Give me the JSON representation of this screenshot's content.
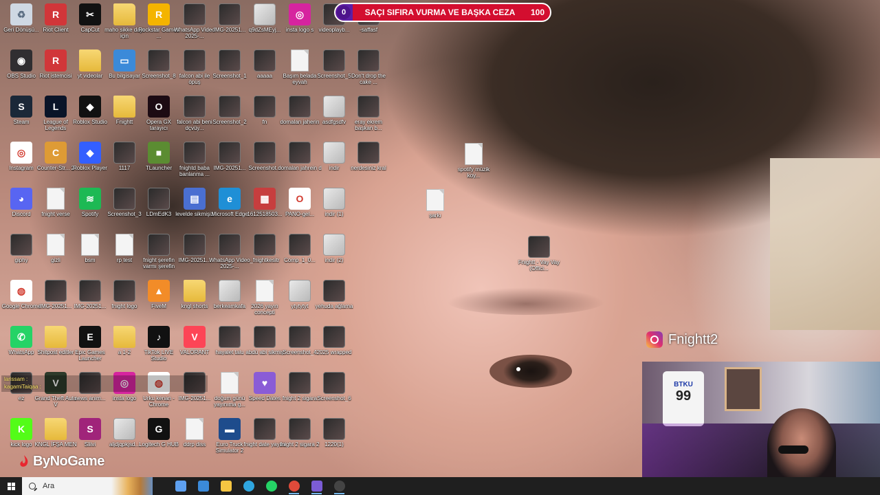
{
  "overlay_goal": {
    "current": "0",
    "title": "SAÇI SIFIRA VURMA VE BAŞKA CEZA",
    "max": "100",
    "progress_fraction": 0.04
  },
  "social_handle": {
    "platform_icon": "instagram-icon",
    "text": "Fnightt2"
  },
  "webcam": {
    "shirt_text": "BTKU",
    "shirt_number": "99"
  },
  "watermark": {
    "brand": "ByNoGame"
  },
  "chat": {
    "lines": [
      "larissam :",
      "kagamiTaiqaa :"
    ]
  },
  "taskbar": {
    "search_placeholder": "Ara",
    "pinned": [
      {
        "name": "copilot-icon",
        "color": "#5ea0ef"
      },
      {
        "name": "microsoft-store-icon",
        "color": "#3b8ad9"
      },
      {
        "name": "file-explorer-icon",
        "color": "#f5c542"
      },
      {
        "name": "edge-icon",
        "color": "#2fa6e0"
      },
      {
        "name": "whatsapp-icon",
        "color": "#25d366"
      },
      {
        "name": "chrome-icon",
        "color": "#e04a3a",
        "active": true
      },
      {
        "name": "speed-dates-icon",
        "color": "#7b5cd6",
        "active": true
      },
      {
        "name": "obs-icon",
        "color": "#444",
        "active": true
      }
    ]
  },
  "desktop_icons": [
    {
      "label": "Geri Dönüşü...",
      "type": "recycle",
      "color": "#cfd8e3"
    },
    {
      "label": "Riot Client",
      "type": "app",
      "color": "#d13639",
      "glyph": "R"
    },
    {
      "label": "CapCut",
      "type": "app",
      "color": "#111",
      "glyph": "✂"
    },
    {
      "label": "maho sikke dayı için",
      "type": "folder"
    },
    {
      "label": "Rockstar Games ...",
      "type": "app",
      "color": "#f4b400",
      "glyph": "R"
    },
    {
      "label": "WhatsApp Video 2025-...",
      "type": "thumb"
    },
    {
      "label": "IMG-20251...",
      "type": "thumb"
    },
    {
      "label": "q9dZsMEyj...",
      "type": "thumb-light"
    },
    {
      "label": "insta logo s",
      "type": "app",
      "color": "#d6249f",
      "glyph": "◎"
    },
    {
      "label": "videoplayb...",
      "type": "thumb"
    },
    {
      "label": "-saffasf",
      "type": "thumb"
    },
    {
      "label": "OBS Studio",
      "type": "app",
      "color": "#302e31",
      "glyph": "◉"
    },
    {
      "label": "Riot istemcisi",
      "type": "app",
      "color": "#d13639",
      "glyph": "R"
    },
    {
      "label": "yt videolar",
      "type": "folder"
    },
    {
      "label": "Bu bilgisayar",
      "type": "app",
      "color": "#3b8ad9",
      "glyph": "▭"
    },
    {
      "label": "Screenshot_8",
      "type": "thumb"
    },
    {
      "label": "falcon abi ile öpüş",
      "type": "thumb"
    },
    {
      "label": "Screenshot_1",
      "type": "thumb"
    },
    {
      "label": "aaaaa",
      "type": "thumb"
    },
    {
      "label": "Başım belada eyvah",
      "type": "doc"
    },
    {
      "label": "Screenshot_5",
      "type": "thumb"
    },
    {
      "label": "Don't drop the cake ...",
      "type": "thumb"
    },
    {
      "label": "Steam",
      "type": "app",
      "color": "#1b2838",
      "glyph": "S"
    },
    {
      "label": "League of Legends",
      "type": "app",
      "color": "#0a1428",
      "glyph": "L"
    },
    {
      "label": "Roblox Studio",
      "type": "app",
      "color": "#111",
      "glyph": "◆"
    },
    {
      "label": "Fnightt",
      "type": "folder"
    },
    {
      "label": "Opera GX tarayıcı",
      "type": "app",
      "color": "#1c0b13",
      "glyph": "O"
    },
    {
      "label": "falcon abi beni dçvüy...",
      "type": "thumb"
    },
    {
      "label": "Screenshot_2",
      "type": "thumb"
    },
    {
      "label": "fn",
      "type": "thumb"
    },
    {
      "label": "domalan jaherin",
      "type": "thumb"
    },
    {
      "label": "asdfgsdfv",
      "type": "thumb-light"
    },
    {
      "label": "eray ekrem başkan b...",
      "type": "thumb"
    },
    {
      "label": "Instagram",
      "type": "app",
      "color": "#ffffff",
      "glyph": "◎"
    },
    {
      "label": "Counter-Str... 2",
      "type": "app",
      "color": "#de9b35",
      "glyph": "C"
    },
    {
      "label": "Roblox Player",
      "type": "app",
      "color": "#335fff",
      "glyph": "◆"
    },
    {
      "label": "1117",
      "type": "thumb"
    },
    {
      "label": "TLauncher",
      "type": "app",
      "color": "#5b8c32",
      "glyph": "■"
    },
    {
      "label": "fnightd baba banlanma ...",
      "type": "thumb"
    },
    {
      "label": "IMG-20251...",
      "type": "thumb"
    },
    {
      "label": "Screenshot...",
      "type": "thumb"
    },
    {
      "label": "domalan jahrein d",
      "type": "thumb"
    },
    {
      "label": "indir",
      "type": "thumb-light"
    },
    {
      "label": "nerdesiniz kral",
      "type": "thumb"
    },
    {
      "label": "Discord",
      "type": "app",
      "color": "#5865f2",
      "glyph": "◕"
    },
    {
      "label": "fnight verse",
      "type": "doc"
    },
    {
      "label": "Spotify",
      "type": "app",
      "color": "#1db954",
      "glyph": "≋"
    },
    {
      "label": "Screenshot_3",
      "type": "thumb"
    },
    {
      "label": "LDmEdK3",
      "type": "thumb"
    },
    {
      "label": "levelde sikmişiz",
      "type": "app",
      "color": "#4a6fd1",
      "glyph": "▤"
    },
    {
      "label": "Microsoft Edge",
      "type": "app",
      "color": "#1f8fd6",
      "glyph": "e"
    },
    {
      "label": "1612518503...",
      "type": "app",
      "color": "#c73e3e",
      "glyph": "▦"
    },
    {
      "label": "PANO-gel...",
      "type": "app",
      "color": "#fff",
      "glyph": "O"
    },
    {
      "label": "indir (1)",
      "type": "thumb-light"
    },
    {
      "label": "giphy",
      "type": "thumb"
    },
    {
      "label": "gizli",
      "type": "doc"
    },
    {
      "label": "bsm",
      "type": "doc"
    },
    {
      "label": "rp test",
      "type": "doc"
    },
    {
      "label": "fnight şerefin varmı şerefin",
      "type": "thumb"
    },
    {
      "label": "IMG-20251...",
      "type": "thumb"
    },
    {
      "label": "WhatsApp Video 2025-...",
      "type": "thumb"
    },
    {
      "label": "_fnightkesitr",
      "type": "thumb"
    },
    {
      "label": "Comp_1_0...",
      "type": "thumb"
    },
    {
      "label": "indir (2)",
      "type": "thumb-light"
    },
    {
      "label": "Google Chrome",
      "type": "app",
      "color": "#fff",
      "glyph": "◍"
    },
    {
      "label": "IMG-20251...",
      "type": "thumb"
    },
    {
      "label": "IMG-20251...",
      "type": "thumb"
    },
    {
      "label": "fnight logo",
      "type": "thumb"
    },
    {
      "label": "FiveM",
      "type": "app",
      "color": "#f28c28",
      "glyph": "▲"
    },
    {
      "label": "kngl shorts",
      "type": "folder"
    },
    {
      "label": "berkeamkafa",
      "type": "thumb-light"
    },
    {
      "label": "2026 yayın concepti",
      "type": "doc"
    },
    {
      "label": "ytytytyt",
      "type": "thumb-light"
    },
    {
      "label": "yehuda ağlama",
      "type": "thumb"
    },
    {
      "label": "WhatsApp",
      "type": "app",
      "color": "#25d366",
      "glyph": "✆"
    },
    {
      "label": "Shitpost editler",
      "type": "folder"
    },
    {
      "label": "Epic Games Launcher",
      "type": "app",
      "color": "#111",
      "glyph": "E"
    },
    {
      "label": "a 1-2",
      "type": "folder"
    },
    {
      "label": "TikTok LIVE Studio",
      "type": "app",
      "color": "#111",
      "glyph": "♪"
    },
    {
      "label": "VALORANT",
      "type": "app",
      "color": "#fd4556",
      "glyph": "V"
    },
    {
      "label": "hayalet talu",
      "type": "thumb"
    },
    {
      "label": "abdü abi sikmiş",
      "type": "thumb"
    },
    {
      "label": "Screenshot_4",
      "type": "thumb"
    },
    {
      "label": "2025 wrapped",
      "type": "thumb"
    },
    {
      "label": "ez",
      "type": "thumb"
    },
    {
      "label": "Grand Theft Auto V",
      "type": "app",
      "color": "#2d3a2a",
      "glyph": "V"
    },
    {
      "label": "news anim...",
      "type": "thumb"
    },
    {
      "label": "insta logo",
      "type": "app",
      "color": "#d6249f",
      "glyph": "◎"
    },
    {
      "label": "Urku kenan - Chrome",
      "type": "app",
      "color": "#fff",
      "glyph": "◍"
    },
    {
      "label": "IMG-20251...",
      "type": "thumb"
    },
    {
      "label": "doğum günü yayınıma g...",
      "type": "doc"
    },
    {
      "label": "Speed Dates",
      "type": "app",
      "color": "#8a5cd6",
      "glyph": "♥"
    },
    {
      "label": "fnight 2 sigara",
      "type": "thumb"
    },
    {
      "label": "Screenshot_6",
      "type": "thumb"
    },
    {
      "label": "kick logo",
      "type": "app",
      "color": "#53fc18",
      "glyph": "K"
    },
    {
      "label": "KNGL İFŞA MEN",
      "type": "folder"
    },
    {
      "label": "Sliivi",
      "type": "app",
      "color": "#a0247a",
      "glyph": "S"
    },
    {
      "label": "aljdjqpkjsd...",
      "type": "thumb-light"
    },
    {
      "label": "Logitech G HUB",
      "type": "app",
      "color": "#111",
      "glyph": "G"
    },
    {
      "label": "ddrp diss",
      "type": "doc"
    },
    {
      "label": "Euro Truck Simulator 2",
      "type": "app",
      "color": "#1e4c8c",
      "glyph": "▬"
    },
    {
      "label": "fnight date yayını",
      "type": "thumb"
    },
    {
      "label": "fnight 2 sigara 2",
      "type": "thumb"
    },
    {
      "label": "1220(1)",
      "type": "thumb"
    },
    {
      "label": "spotify müzik koy...",
      "type": "doc"
    },
    {
      "label": "şarkı",
      "type": "doc"
    },
    {
      "label": "Fnightt - Vay Vay (Offici...",
      "type": "thumb"
    }
  ]
}
